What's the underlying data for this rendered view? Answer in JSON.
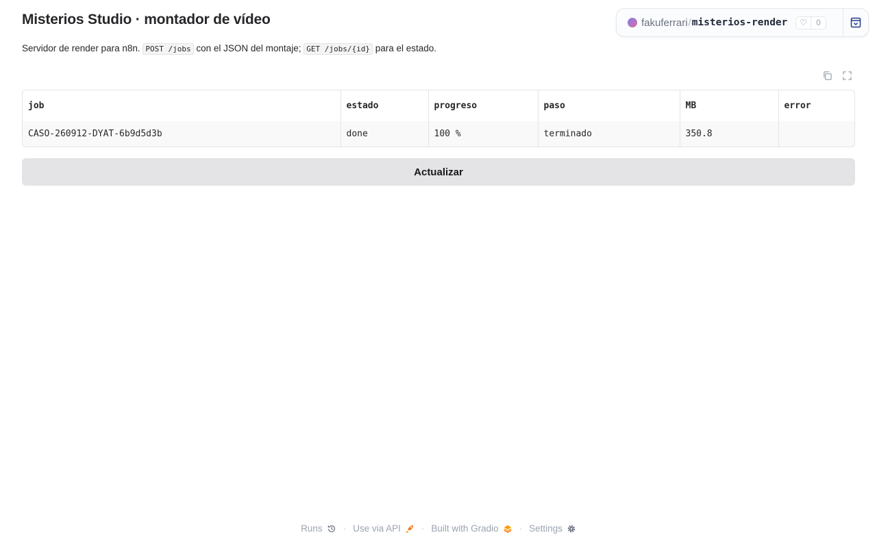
{
  "header": {
    "title": "Misterios Studio · montador de vídeo",
    "subtitle": {
      "part1": "Servidor de render para n8n.",
      "code1": "POST /jobs",
      "part2": "con el JSON del montaje;",
      "code2": "GET /jobs/{id}",
      "part3": "para el estado."
    }
  },
  "hf_badge": {
    "owner": "fakuferrari",
    "repo": "misterios-render",
    "likes": "0"
  },
  "table": {
    "columns": [
      "job",
      "estado",
      "progreso",
      "paso",
      "MB",
      "error"
    ],
    "rows": [
      [
        "CASO-260912-DYAT-6b9d5d3b",
        "done",
        "100 %",
        "terminado",
        "350.8",
        ""
      ]
    ]
  },
  "refresh_button": {
    "label": "Actualizar"
  },
  "footer": {
    "runs": "Runs",
    "api": "Use via API",
    "built": "Built with Gradio",
    "settings": "Settings"
  },
  "colors": {
    "accent": "#f97316",
    "button_bg": "#e4e4e7"
  }
}
